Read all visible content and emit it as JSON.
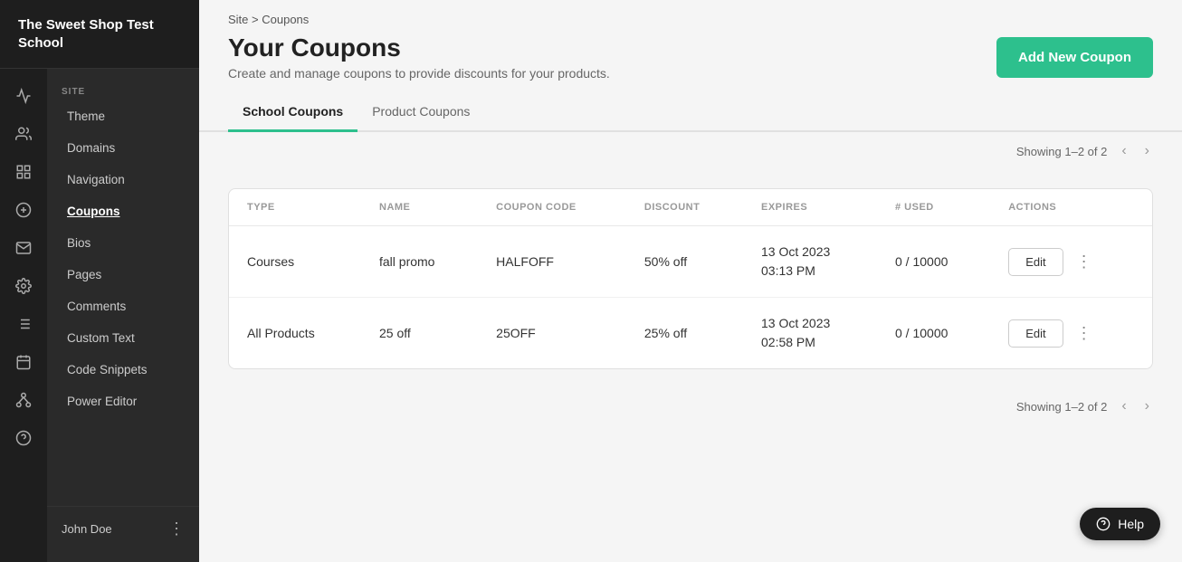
{
  "sidebar": {
    "logo": "The Sweet Shop Test School",
    "section_label": "SITE",
    "items": [
      {
        "id": "theme",
        "label": "Theme",
        "active": false
      },
      {
        "id": "domains",
        "label": "Domains",
        "active": false
      },
      {
        "id": "navigation",
        "label": "Navigation",
        "active": false
      },
      {
        "id": "coupons",
        "label": "Coupons",
        "active": true
      },
      {
        "id": "bios",
        "label": "Bios",
        "active": false
      },
      {
        "id": "pages",
        "label": "Pages",
        "active": false
      },
      {
        "id": "comments",
        "label": "Comments",
        "active": false
      },
      {
        "id": "custom-text",
        "label": "Custom Text",
        "active": false
      },
      {
        "id": "code-snippets",
        "label": "Code Snippets",
        "active": false
      },
      {
        "id": "power-editor",
        "label": "Power Editor",
        "active": false
      }
    ],
    "footer": {
      "user_name": "John Doe"
    }
  },
  "breadcrumb": {
    "site": "Site",
    "separator": ">",
    "current": "Coupons"
  },
  "header": {
    "title": "Your Coupons",
    "subtitle": "Create and manage coupons to provide discounts for your products.",
    "add_button_label": "Add New Coupon"
  },
  "tabs": [
    {
      "id": "school-coupons",
      "label": "School Coupons",
      "active": true
    },
    {
      "id": "product-coupons",
      "label": "Product Coupons",
      "active": false
    }
  ],
  "pagination": {
    "showing": "Showing 1–2 of 2"
  },
  "table": {
    "columns": [
      {
        "id": "type",
        "label": "TYPE"
      },
      {
        "id": "name",
        "label": "NAME"
      },
      {
        "id": "coupon_code",
        "label": "COUPON CODE"
      },
      {
        "id": "discount",
        "label": "DISCOUNT"
      },
      {
        "id": "expires",
        "label": "EXPIRES"
      },
      {
        "id": "used",
        "label": "# USED"
      },
      {
        "id": "actions",
        "label": "ACTIONS"
      }
    ],
    "rows": [
      {
        "type": "Courses",
        "name": "fall promo",
        "coupon_code": "HALFOFF",
        "discount": "50% off",
        "expires_line1": "13 Oct 2023",
        "expires_line2": "03:13 PM",
        "used": "0 / 10000",
        "edit_label": "Edit"
      },
      {
        "type": "All Products",
        "name": "25 off",
        "coupon_code": "25OFF",
        "discount": "25% off",
        "expires_line1": "13 Oct 2023",
        "expires_line2": "02:58 PM",
        "used": "0 / 10000",
        "edit_label": "Edit"
      }
    ]
  },
  "help_button": {
    "label": "Help",
    "icon": "?"
  },
  "icons": {
    "chart": "📊",
    "people": "👥",
    "dashboard": "▦",
    "money": "◎",
    "mail": "✉",
    "gear": "⚙",
    "book": "☰",
    "calendar": "▦",
    "network": "◈",
    "question": "?"
  }
}
